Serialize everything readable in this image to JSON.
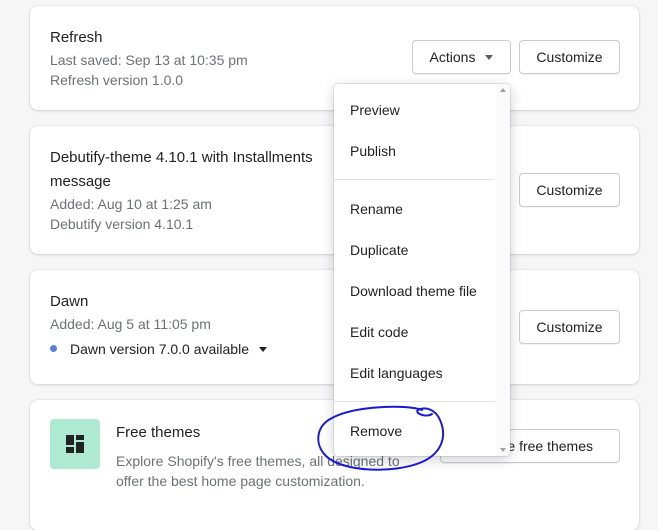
{
  "themes": [
    {
      "name": "Refresh",
      "meta_lines": [
        "Last saved: Sep 13 at 10:35 pm",
        "Refresh version 1.0.0"
      ],
      "actions_label": "Actions",
      "customize_label": "Customize"
    },
    {
      "name_lines": [
        "Debutify-theme 4.10.1 with Installments",
        "message"
      ],
      "meta_lines": [
        "Added: Aug 10 at 1:25 am",
        "Debutify version 4.10.1"
      ],
      "customize_label": "Customize"
    },
    {
      "name": "Dawn",
      "meta_lines": [
        "Added: Aug 5 at 11:05 pm"
      ],
      "update_label": "Dawn version 7.0.0 available",
      "customize_label": "Customize"
    }
  ],
  "free_themes": {
    "title": "Free themes",
    "description": "Explore Shopify's free themes, all designed to offer the best home page customization.",
    "button_label": "e free themes"
  },
  "actions_menu": {
    "group1": [
      "Preview",
      "Publish"
    ],
    "group2": [
      "Rename",
      "Duplicate",
      "Download theme file",
      "Edit code",
      "Edit languages"
    ],
    "group3": [
      "Remove"
    ]
  },
  "colors": {
    "accent_dot": "#5b7fd8",
    "free_icon_bg": "#aee9d1",
    "annotation_ink": "#1a1ad6"
  },
  "icons": {
    "caret": "caret-down-icon",
    "free_themes": "theme-layout-icon"
  }
}
